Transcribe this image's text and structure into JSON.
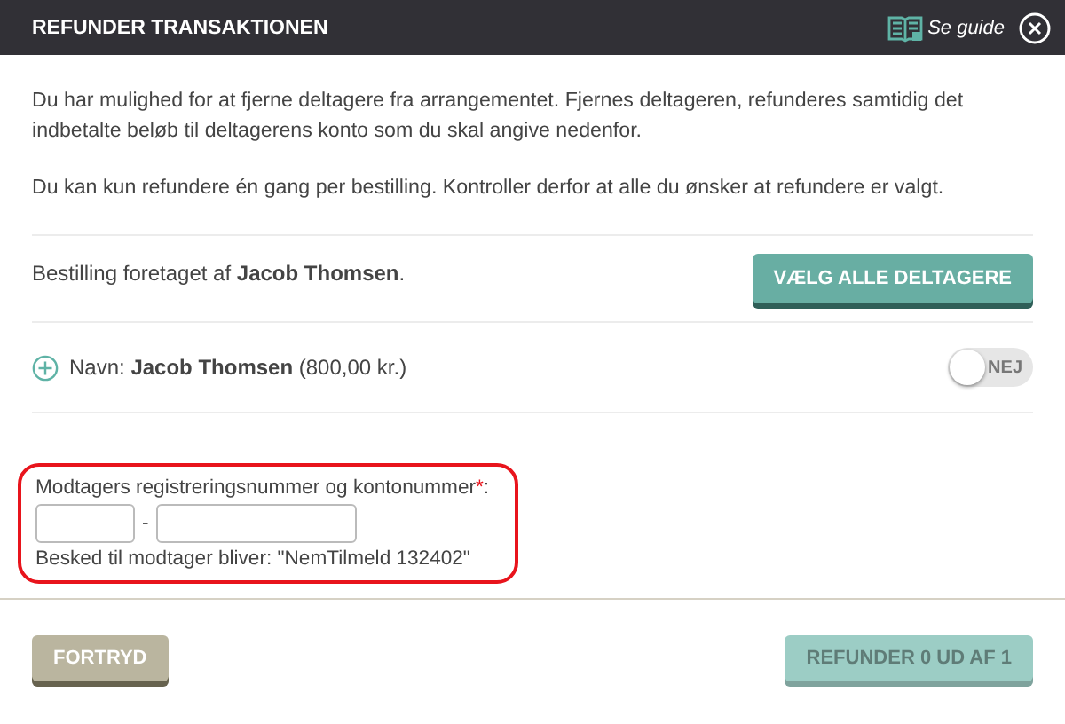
{
  "window": {
    "title": "REFUNDER TRANSAKTIONEN",
    "guide_link": "Se guide"
  },
  "intro": [
    "Du har mulighed for at fjerne deltagere fra arrangementet. Fjernes deltageren, refunderes samtidig det indbetalte beløb til deltagerens konto som du skal angive nedenfor.",
    "Du kan kun refundere én gang per bestilling. Kontroller derfor at alle du ønsker at refundere er valgt."
  ],
  "order": {
    "text": "Bestilling foretaget af **Jacob Thomsen**.",
    "select_all_button": "VÆLG ALLE DELTAGERE"
  },
  "participants": [
    {
      "text": "Navn: **Jacob Thomsen** (800,00 kr.)",
      "on": false,
      "toggle_label": "NEJ"
    }
  ],
  "account": {
    "label": "Modtagers registreringsnummer og kontonummer",
    "required_mark": "*",
    "label_suffix": ":",
    "separator": "-",
    "message": "Besked til modtager bliver: \"NemTilmeld 132402\"",
    "highlighted": true
  },
  "footer": {
    "cancel_button": {
      "label": "FORTRYD",
      "disabled": false
    },
    "refund_button": {
      "label": "REFUNDER 0 UD AF 1",
      "disabled": true
    }
  }
}
